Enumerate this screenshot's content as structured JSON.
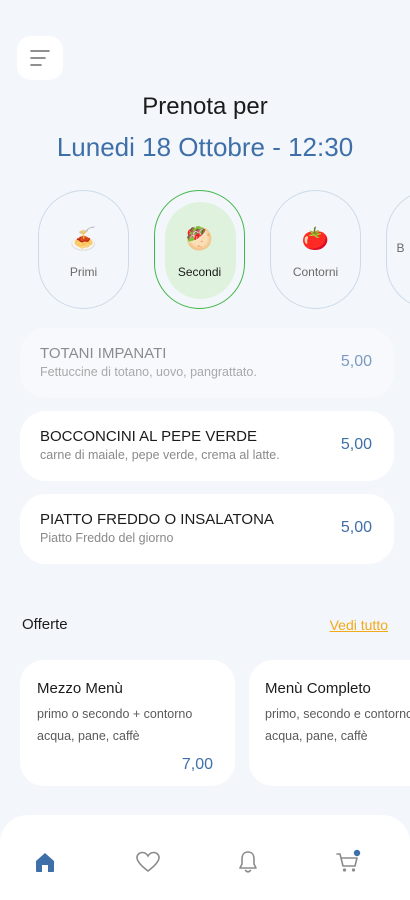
{
  "header": {
    "title": "Prenota per",
    "datetime": "Lunedi 18 Ottobre - 12:30"
  },
  "categories": [
    {
      "label": "Primi",
      "icon": "pasta-icon",
      "emoji": "🍝",
      "selected": false
    },
    {
      "label": "Secondi",
      "icon": "meat-icon",
      "emoji": "🥙",
      "selected": true
    },
    {
      "label": "Contorni",
      "icon": "tomato-icon",
      "emoji": "🍅",
      "selected": false
    },
    {
      "label": "B",
      "icon": "partial-icon",
      "emoji": "",
      "selected": false
    }
  ],
  "items": [
    {
      "name": "TOTANI IMPANATI",
      "desc": "Fettuccine di totano, uovo, pangrattato.",
      "price": "5,00",
      "dim": true
    },
    {
      "name": "BOCCONCINI AL PEPE VERDE",
      "desc": "carne di maiale, pepe verde, crema al latte.",
      "price": "5,00",
      "dim": false
    },
    {
      "name": "PIATTO FREDDO O INSALATONA",
      "desc": "Piatto Freddo del giorno",
      "price": "5,00",
      "dim": false
    }
  ],
  "offers": {
    "title": "Offerte",
    "see_all": "Vedi tutto",
    "cards": [
      {
        "name": "Mezzo Menù",
        "line1": "primo o secondo + contorno",
        "line2": "acqua, pane, caffè",
        "price": "7,00"
      },
      {
        "name": "Menù Completo",
        "line1": "primo, secondo e contorno",
        "line2": "acqua, pane, caffè",
        "price": ""
      }
    ]
  },
  "nav": {
    "items": [
      "home-icon",
      "heart-icon",
      "bell-icon",
      "cart-icon"
    ],
    "active": "home-icon"
  },
  "colors": {
    "accent": "#3f6fa8",
    "selected_green": "#43b64a",
    "link": "#f4a91a",
    "background": "#f3f7fb"
  }
}
